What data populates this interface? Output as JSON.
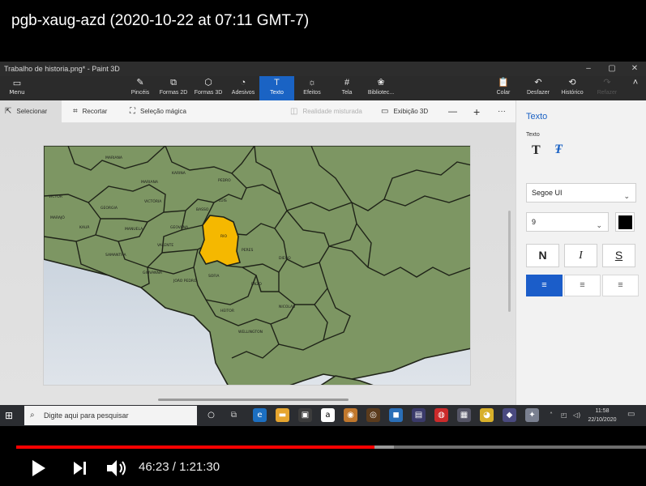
{
  "video": {
    "title": "pgb-xaug-azd (2020-10-22 at 07:11 GMT-7)",
    "time_current": "46:23",
    "time_total": "1:21:30",
    "time_separator": " / ",
    "progress_fraction": 0.569,
    "buffered_fraction": 0.6
  },
  "window": {
    "title": "Trabalho de historia.png* - Paint 3D",
    "minimize": "–",
    "maximize": "▢",
    "close": "✕"
  },
  "ribbon": {
    "menu": "Menu",
    "tools": [
      {
        "label": "Pincéis",
        "icon": "brush-icon"
      },
      {
        "label": "Formas 2D",
        "icon": "shapes-2d-icon"
      },
      {
        "label": "Formas 3D",
        "icon": "shapes-3d-icon"
      },
      {
        "label": "Adesivos",
        "icon": "stickers-icon"
      },
      {
        "label": "Texto",
        "icon": "text-icon"
      },
      {
        "label": "Efeitos",
        "icon": "effects-icon"
      },
      {
        "label": "Tela",
        "icon": "canvas-icon"
      },
      {
        "label": "Bibliotec...",
        "icon": "library-icon"
      }
    ],
    "right_tools": [
      {
        "label": "Colar",
        "icon": "paste-icon"
      },
      {
        "label": "Desfazer",
        "icon": "undo-icon"
      },
      {
        "label": "Histórico",
        "icon": "history-icon"
      },
      {
        "label": "Refazer",
        "icon": "redo-icon"
      }
    ]
  },
  "subbar": {
    "select": "Selecionar",
    "crop": "Recortar",
    "magic_select": "Seleção mágica",
    "mixed_reality": "Realidade misturada",
    "view_3d": "Exibição 3D",
    "zoom_out": "—",
    "zoom_in": "+",
    "more": "···"
  },
  "panel": {
    "title": "Texto",
    "subtitle": "Texto",
    "font": "Segoe UI",
    "size": "9",
    "bold": "N",
    "italic": "I",
    "strike": "S",
    "text_color": "#000000",
    "align_left": "≡",
    "align_center": "≡",
    "align_right": "≡"
  },
  "map": {
    "highlight_color": "#f5b800",
    "land_color": "#7b9560",
    "water_color": "#c8d2de",
    "regions": [
      "VICTOR",
      "MARAJÓ",
      "KARINA",
      "PEDRO",
      "LUIS",
      "GEORGIA",
      "VICTÓRIA",
      "BASSO",
      "KAUÃ",
      "MANUELA",
      "GEOVANA",
      "VALENTE",
      "SAMANTHA",
      "GIOVANNA",
      "JOÃO PEDRO",
      "SOFIA",
      "PERES",
      "DIEGO",
      "ENZO",
      "NICOLAS",
      "HEITOR",
      "WELLINGTON",
      "RIO",
      "MARIANA",
      "MARIANA"
    ]
  },
  "taskbar": {
    "search_placeholder": "Digite aqui para pesquisar",
    "clock_time": "11:58",
    "clock_date": "22/10/2020"
  },
  "colors": {
    "accent": "#1a63c4",
    "youtube_red": "#ff0000"
  }
}
